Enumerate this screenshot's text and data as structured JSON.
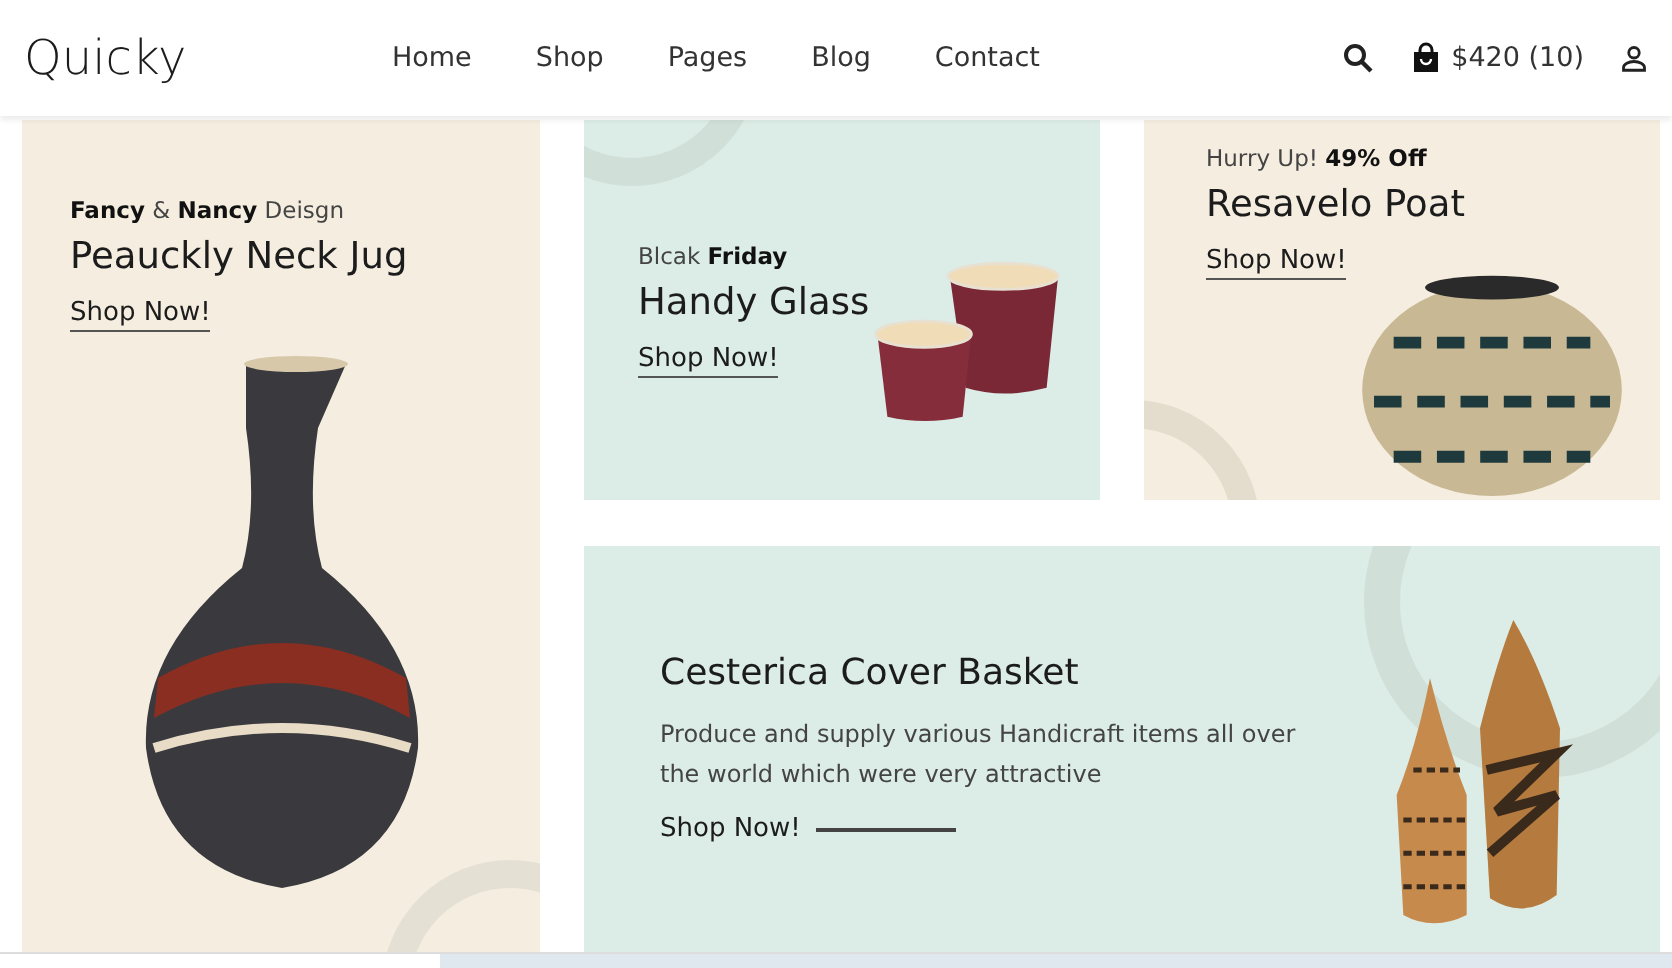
{
  "header": {
    "logo": "Quicky",
    "nav": [
      {
        "label": "Home"
      },
      {
        "label": "Shop"
      },
      {
        "label": "Pages"
      },
      {
        "label": "Blog"
      },
      {
        "label": "Contact"
      }
    ],
    "cart": "$420 (10)"
  },
  "banners": [
    {
      "kind": "tall",
      "eyebrow": "**Fancy** & **Nancy** Deisgn",
      "title": "Peauckly Neck Jug",
      "link": "Shop Now!"
    },
    {
      "kind": "side",
      "eyebrow": "Blcak **Friday**",
      "title": "Handy Glass",
      "link": "Shop Now!"
    },
    {
      "kind": "stack",
      "eyebrow": "Hurry Up! **49% Off**",
      "title": "Resavelo Poat",
      "link": "Shop Now!"
    },
    {
      "kind": "wide",
      "title": "Cesterica Cover Basket",
      "text": "Produce and supply various Handicraft items all over the world which were very attractive",
      "link": "Shop Now!"
    }
  ]
}
